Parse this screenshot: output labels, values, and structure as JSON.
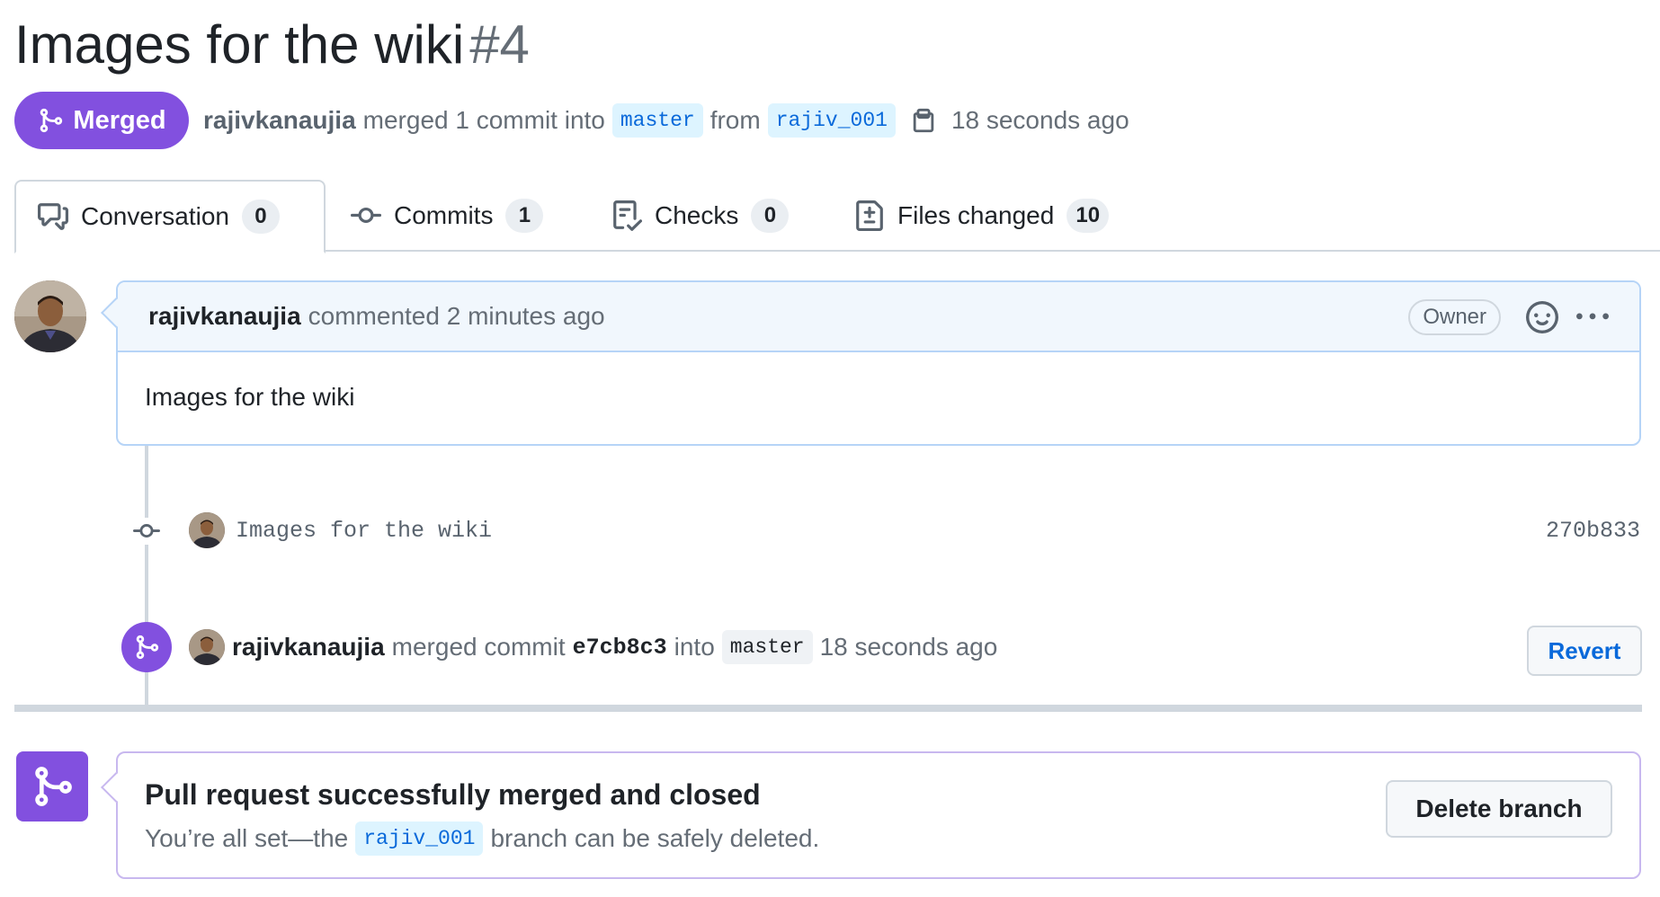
{
  "header": {
    "title": "Images for the wiki",
    "number": "#4",
    "status_label": "Merged",
    "author": "rajivkanaujia",
    "merge_text": "merged 1 commit into",
    "base_branch": "master",
    "from_text": "from",
    "head_branch": "rajiv_001",
    "time": "18 seconds ago"
  },
  "tabs": [
    {
      "label": "Conversation",
      "count": "0",
      "icon": "comment-discussion-icon"
    },
    {
      "label": "Commits",
      "count": "1",
      "icon": "git-commit-icon"
    },
    {
      "label": "Checks",
      "count": "0",
      "icon": "checklist-icon"
    },
    {
      "label": "Files changed",
      "count": "10",
      "icon": "file-diff-icon"
    }
  ],
  "comment": {
    "author": "rajivkanaujia",
    "meta": "commented 2 minutes ago",
    "role_badge": "Owner",
    "body": "Images for the wiki"
  },
  "timeline": {
    "commit": {
      "message": "Images for the wiki",
      "sha": "270b833"
    },
    "merge": {
      "author": "rajivkanaujia",
      "text_before": "merged commit",
      "sha": "e7cb8c3",
      "text_into": "into",
      "branch": "master",
      "time": "18 seconds ago",
      "revert_label": "Revert"
    }
  },
  "merge_box": {
    "title": "Pull request successfully merged and closed",
    "sub_before": "You’re all set—the",
    "branch": "rajiv_001",
    "sub_after": "branch can be safely deleted.",
    "delete_label": "Delete branch"
  },
  "colors": {
    "merged_purple": "#8250df",
    "link_blue": "#0969da",
    "comment_header_bg": "#f1f7fd"
  }
}
